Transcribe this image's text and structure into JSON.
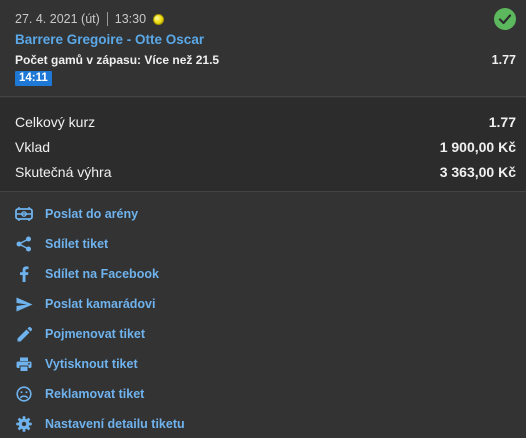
{
  "bet": {
    "date": "27. 4. 2021 (út)",
    "time": "13:30",
    "sport_icon": "tennis-ball-icon",
    "status_icon": "check-circle-icon",
    "match": "Barrere Gregoire - Otte Oscar",
    "market": "Počet gamů v zápasu: Více než 21.5",
    "odd": "1.77",
    "live_time": "14:11"
  },
  "summary": {
    "rows": [
      {
        "label": "Celkový kurz",
        "value": "1.77"
      },
      {
        "label": "Vklad",
        "value": "1 900,00 Kč"
      },
      {
        "label": "Skutečná výhra",
        "value": "3 363,00 Kč"
      }
    ]
  },
  "actions": [
    {
      "label": "Poslat do arény",
      "icon": "arena-icon"
    },
    {
      "label": "Sdílet tiket",
      "icon": "share-icon"
    },
    {
      "label": "Sdílet na Facebook",
      "icon": "facebook-icon"
    },
    {
      "label": "Poslat kamarádovi",
      "icon": "send-icon"
    },
    {
      "label": "Pojmenovat tiket",
      "icon": "pencil-icon"
    },
    {
      "label": "Vytisknout tiket",
      "icon": "print-icon"
    },
    {
      "label": "Reklamovat tiket",
      "icon": "sad-face-icon"
    },
    {
      "label": "Nastavení detailu tiketu",
      "icon": "gear-icon"
    }
  ],
  "colors": {
    "background": "#333333",
    "summary_background": "#2c2c2c",
    "link": "#6fb3ee",
    "match": "#5aa8e8",
    "badge": "#1e78d6",
    "success": "#5cb85c"
  }
}
